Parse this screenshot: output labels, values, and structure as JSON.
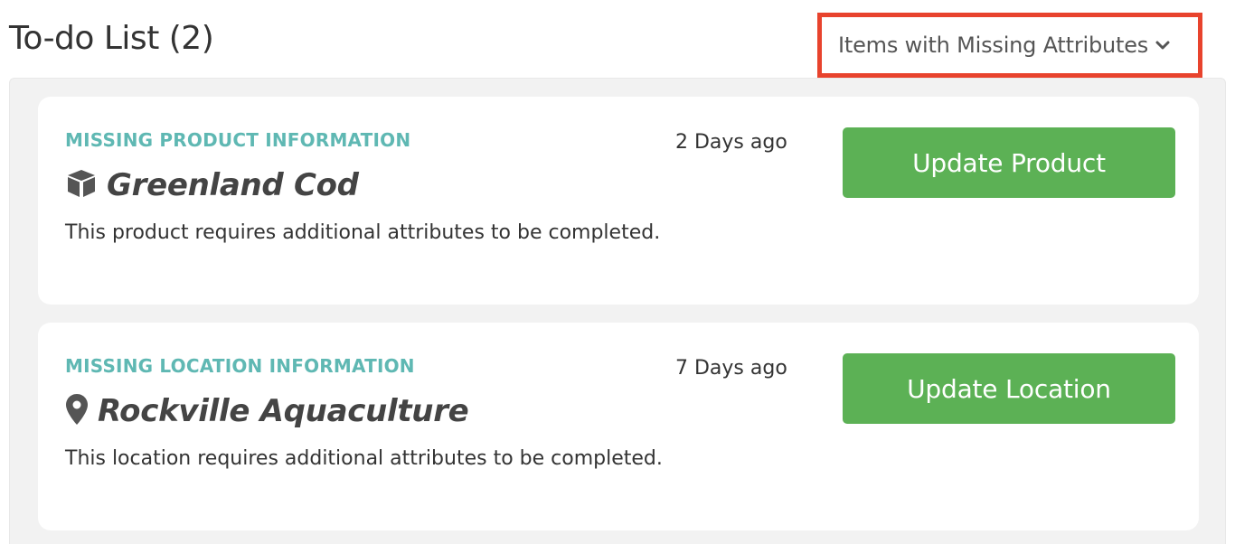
{
  "header": {
    "title": "To-do List (2)",
    "filter_label": "Items with Missing Attributes",
    "filter_icon": "chevron-down-icon"
  },
  "colors": {
    "accent_red": "#e8432d",
    "category_teal": "#5fb8b3",
    "button_green": "#5cb155",
    "panel_bg": "#f2f2f2"
  },
  "items": [
    {
      "category": "MISSING PRODUCT INFORMATION",
      "time": "2 Days ago",
      "icon": "cube-icon",
      "name": "Greenland Cod",
      "description": "This product requires additional attributes to be completed.",
      "button_label": "Update Product"
    },
    {
      "category": "MISSING LOCATION INFORMATION",
      "time": "7 Days ago",
      "icon": "map-marker-icon",
      "name": "Rockville Aquaculture",
      "description": "This location requires additional attributes to be completed.",
      "button_label": "Update Location"
    }
  ]
}
